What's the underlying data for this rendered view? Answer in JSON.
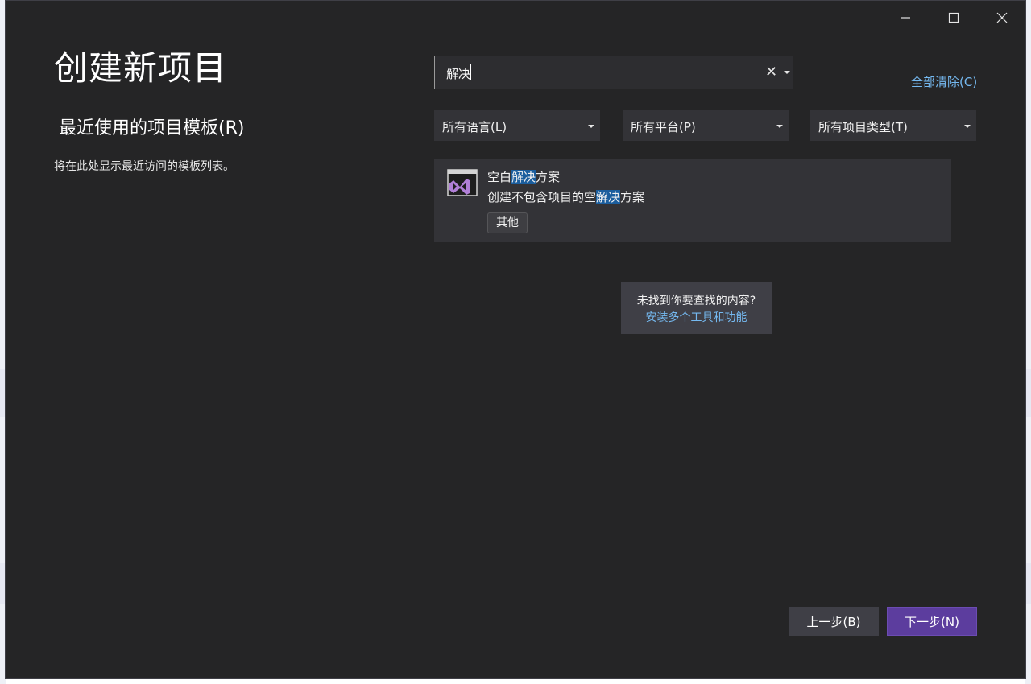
{
  "window": {
    "controls": [
      "minimize-icon",
      "maximize-icon",
      "close-icon"
    ]
  },
  "header": {
    "title": "创建新项目"
  },
  "recent": {
    "title": "最近使用的项目模板(R)",
    "empty_message": "将在此处显示最近访问的模板列表。"
  },
  "search": {
    "value": "解决",
    "clear_glyph": "✕"
  },
  "clear_all_label": "全部清除(C)",
  "filters": [
    {
      "label": "所有语言(L)"
    },
    {
      "label": "所有平台(P)"
    },
    {
      "label": "所有项目类型(T)"
    }
  ],
  "templates": [
    {
      "name_before": "空白",
      "name_match": "解决",
      "name_after": "方案",
      "desc_before": "创建不包含项目的空",
      "desc_match": "解决",
      "desc_after": "方案",
      "tag": "其他",
      "icon": "vs-solution-icon"
    }
  ],
  "not_found": {
    "question": "未找到你要查找的内容?",
    "link": "安装多个工具和功能"
  },
  "footer": {
    "back_label": "上一步(B)",
    "next_label": "下一步(N)"
  },
  "colors": {
    "background": "#252526",
    "accent": "#5c3d9e",
    "link": "#75b9f0",
    "highlight": "#1b5e9e"
  }
}
